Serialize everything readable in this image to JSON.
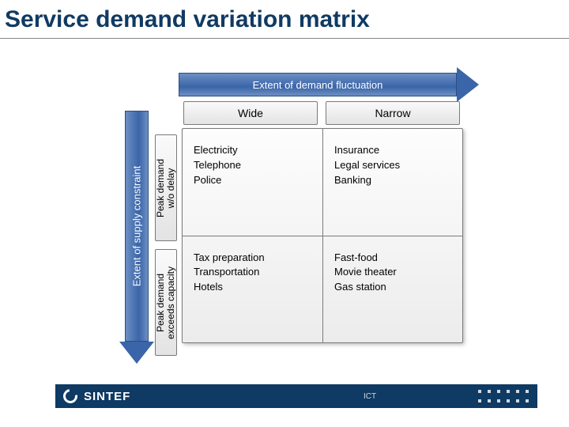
{
  "title": "Service demand variation matrix",
  "axes": {
    "horizontal": "Extent of demand fluctuation",
    "vertical": "Extent of supply constraint"
  },
  "columns": {
    "left": "Wide",
    "right": "Narrow"
  },
  "rows": {
    "top": "Peak demand\nw/o delay",
    "bottom": "Peak demand\nexceeds capacity"
  },
  "cells": {
    "top_left": "Electricity\nTelephone\nPolice",
    "top_right": "Insurance\nLegal services\nBanking",
    "bot_left": "Tax preparation\nTransportation\nHotels",
    "bot_right": "Fast-food\nMovie theater\nGas station"
  },
  "footer": {
    "brand": "SINTEF",
    "dept": "ICT"
  },
  "chart_data": {
    "type": "table",
    "title": "Service demand variation matrix",
    "x_axis": "Extent of demand fluctuation",
    "y_axis": "Extent of supply constraint",
    "columns": [
      "Wide",
      "Narrow"
    ],
    "rows": [
      "Peak demand w/o delay",
      "Peak demand exceeds capacity"
    ],
    "data": [
      [
        [
          "Electricity",
          "Telephone",
          "Police"
        ],
        [
          "Insurance",
          "Legal services",
          "Banking"
        ]
      ],
      [
        [
          "Tax preparation",
          "Transportation",
          "Hotels"
        ],
        [
          "Fast-food",
          "Movie theater",
          "Gas station"
        ]
      ]
    ]
  }
}
